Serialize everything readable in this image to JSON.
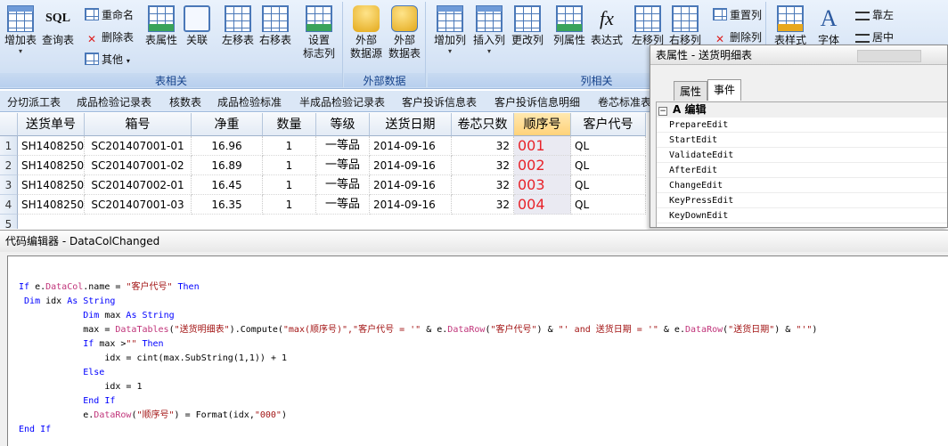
{
  "ribbon": {
    "groups": [
      {
        "label": "表相关"
      },
      {
        "label": "外部数据"
      },
      {
        "label": "列相关"
      }
    ],
    "buttons": {
      "add_table": "增加表",
      "query_table": "查询表",
      "rename": "重命名",
      "delete_table": "删除表",
      "other": "其他",
      "table_props": "表属性",
      "relation": "关联",
      "move_left_table": "左移表",
      "move_right_table": "右移表",
      "set_title_col_1": "设置",
      "set_title_col_2": "标志列",
      "ext_source_1": "外部",
      "ext_source_2": "数据源",
      "ext_table_1": "外部",
      "ext_table_2": "数据表",
      "add_col": "增加列",
      "insert_col": "插入列",
      "modify_col": "更改列",
      "col_props": "列属性",
      "expression": "表达式",
      "move_left_col": "左移列",
      "move_right_col": "右移列",
      "reset_col": "重置列",
      "delete_col": "删除列",
      "table_style": "表样式",
      "font": "字体",
      "align_left": "靠左",
      "align_center": "居中",
      "sql_glyph": "SQL",
      "fx_glyph": "fx",
      "font_glyph": "A"
    }
  },
  "tabs": [
    "分切派工表",
    "成品检验记录表",
    "核数表",
    "成品检验标准",
    "半成品检验记录表",
    "客户投诉信息表",
    "客户投诉信息明细",
    "卷芯标准表"
  ],
  "grid": {
    "columns": [
      "送货单号",
      "箱号",
      "净重",
      "数量",
      "等级",
      "送货日期",
      "卷芯只数",
      "顺序号",
      "客户代号"
    ],
    "selected_column": "顺序号",
    "rows": [
      {
        "num": "1",
        "cells": [
          "SH1408250",
          "SC201407001-01",
          "16.96",
          "1",
          "一等品",
          "2014-09-16",
          "32",
          "001",
          "QL"
        ]
      },
      {
        "num": "2",
        "cells": [
          "SH1408250",
          "SC201407001-02",
          "16.89",
          "1",
          "一等品",
          "2014-09-16",
          "32",
          "002",
          "QL"
        ]
      },
      {
        "num": "3",
        "cells": [
          "SH1408250",
          "SC201407002-01",
          "16.45",
          "1",
          "一等品",
          "2014-09-16",
          "32",
          "003",
          "QL"
        ]
      },
      {
        "num": "4",
        "cells": [
          "SH1408250",
          "SC201407001-03",
          "16.35",
          "1",
          "一等品",
          "2014-09-16",
          "32",
          "004",
          "QL"
        ]
      },
      {
        "num": "5",
        "cells": [
          "",
          "",
          "",
          "",
          "",
          "",
          "",
          "",
          ""
        ]
      }
    ]
  },
  "property_panel": {
    "title": "表属性 - 送货明细表",
    "tabs": [
      "属性",
      "事件"
    ],
    "active_tab": "事件",
    "category": "A 编辑",
    "category_toggle": "−",
    "events": [
      "PrepareEdit",
      "StartEdit",
      "ValidateEdit",
      "AfterEdit",
      "ChangeEdit",
      "KeyPressEdit",
      "KeyDownEdit"
    ]
  },
  "editor": {
    "title": "代码编辑器 - DataColChanged",
    "code_lines": [
      [
        {
          "t": "If",
          "c": "kw"
        },
        {
          "t": " e."
        },
        {
          "t": "DataCol",
          "c": "prop"
        },
        {
          "t": ".name = "
        },
        {
          "t": "\"客户代号\"",
          "c": "str"
        },
        {
          "t": " "
        },
        {
          "t": "Then",
          "c": "kw"
        }
      ],
      [
        {
          "t": " "
        },
        {
          "t": "Dim",
          "c": "kw"
        },
        {
          "t": " idx "
        },
        {
          "t": "As",
          "c": "kw"
        },
        {
          "t": " "
        },
        {
          "t": "String",
          "c": "kw"
        }
      ],
      [
        {
          "t": "            "
        },
        {
          "t": "Dim",
          "c": "kw"
        },
        {
          "t": " max "
        },
        {
          "t": "As",
          "c": "kw"
        },
        {
          "t": " "
        },
        {
          "t": "String",
          "c": "kw"
        }
      ],
      [
        {
          "t": "            max = "
        },
        {
          "t": "DataTables",
          "c": "prop"
        },
        {
          "t": "("
        },
        {
          "t": "\"送货明细表\"",
          "c": "str"
        },
        {
          "t": ").Compute("
        },
        {
          "t": "\"max(顺序号)\",\"客户代号 = '\"",
          "c": "str"
        },
        {
          "t": " & e."
        },
        {
          "t": "DataRow",
          "c": "prop"
        },
        {
          "t": "("
        },
        {
          "t": "\"客户代号\"",
          "c": "str"
        },
        {
          "t": ") & "
        },
        {
          "t": "\"' and 送货日期 = '\"",
          "c": "str"
        },
        {
          "t": " & e."
        },
        {
          "t": "DataRow",
          "c": "prop"
        },
        {
          "t": "("
        },
        {
          "t": "\"送货日期\"",
          "c": "str"
        },
        {
          "t": ") & "
        },
        {
          "t": "\"'\"",
          "c": "str"
        },
        {
          "t": ")"
        }
      ],
      [
        {
          "t": "            "
        },
        {
          "t": "If",
          "c": "kw"
        },
        {
          "t": " max >"
        },
        {
          "t": "\"\"",
          "c": "str"
        },
        {
          "t": " "
        },
        {
          "t": "Then",
          "c": "kw"
        }
      ],
      [
        {
          "t": "                idx = cint(max.SubString(1,1)) + 1"
        }
      ],
      [
        {
          "t": "            "
        },
        {
          "t": "Else",
          "c": "kw"
        }
      ],
      [
        {
          "t": "                idx = 1"
        }
      ],
      [
        {
          "t": "            "
        },
        {
          "t": "End If",
          "c": "kw"
        }
      ],
      [
        {
          "t": "            e."
        },
        {
          "t": "DataRow",
          "c": "prop"
        },
        {
          "t": "("
        },
        {
          "t": "\"顺序号\"",
          "c": "str"
        },
        {
          "t": ") = Format(idx,"
        },
        {
          "t": "\"000\"",
          "c": "str"
        },
        {
          "t": ")"
        }
      ],
      [
        {
          "t": "End If",
          "c": "kw"
        }
      ]
    ]
  },
  "colors": {
    "accent": "#15428b",
    "seq_red": "#e8232a",
    "keyword": "#0000ff",
    "string": "#a31515"
  }
}
